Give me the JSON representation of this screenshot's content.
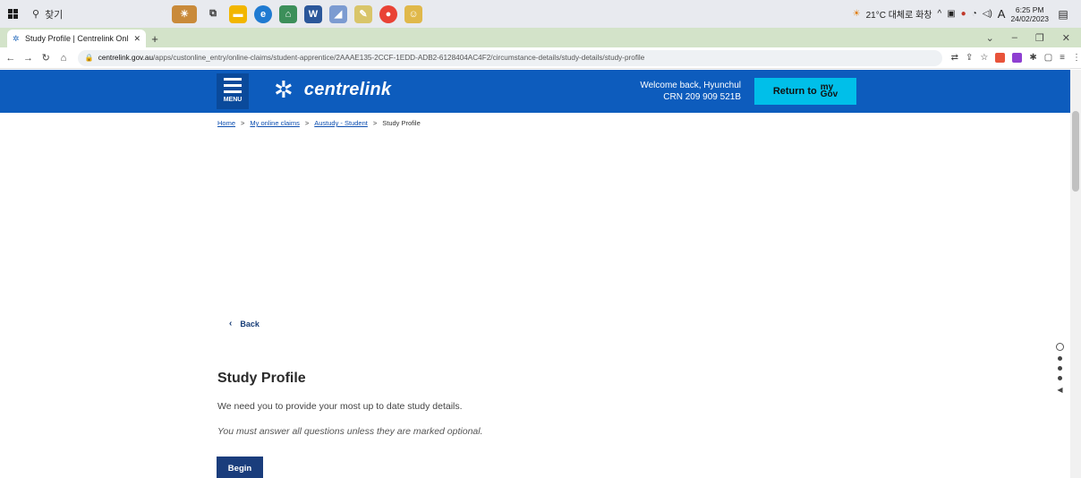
{
  "taskbar": {
    "search_placeholder": "찾기",
    "weather": "21°C 대체로 화창",
    "input_lang": "A",
    "time": "6:25 PM",
    "date": "24/02/2023"
  },
  "browser": {
    "tab_title": "Study Profile | Centrelink Online",
    "url_host": "centrelink.gov.au",
    "url_path": "/apps/custonline_entry/online-claims/student-apprentice/2AAAE135-2CCF-1EDD-ADB2-6128404AC4F2/circumstance-details/study-details/study-profile"
  },
  "header": {
    "menu_label": "MENU",
    "logo_text": "centrelink",
    "welcome_line1": "Welcome back, Hyunchul",
    "welcome_line2": "CRN 209 909 521B",
    "return_label": "Return to",
    "mygov_top": "my",
    "mygov_bottom": "Gov"
  },
  "breadcrumb": {
    "items": [
      {
        "label": "Home"
      },
      {
        "label": "My online claims"
      },
      {
        "label": "Austudy - Student"
      },
      {
        "label": "Study Profile"
      }
    ],
    "separator": ">"
  },
  "main": {
    "back_label": "Back",
    "title": "Study Profile",
    "intro": "We need you to provide your most up to date study details.",
    "note": "You must answer all questions unless they are marked optional.",
    "begin_label": "Begin"
  },
  "colors": {
    "header_bg": "#0d5cbd",
    "mygov_button": "#00bfe9",
    "primary_button": "#1a3d7c"
  }
}
